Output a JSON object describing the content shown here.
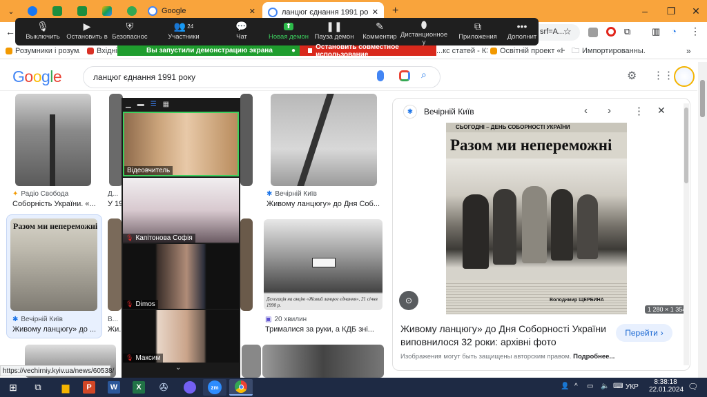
{
  "browser": {
    "tabs": [
      {
        "label": "",
        "icon": "facebook-icon",
        "color": "#1877f2"
      },
      {
        "label": "",
        "icon": "sheets-icon",
        "color": "#1e8e3e"
      },
      {
        "label": "",
        "icon": "sheets-icon",
        "color": "#1e8e3e"
      },
      {
        "label": "",
        "icon": "drive-icon",
        "color": "#f4b400"
      },
      {
        "label": "",
        "icon": "app-icon",
        "color": "#34a853"
      },
      {
        "label": "Google",
        "icon": "google-icon",
        "color": "#4285f4"
      },
      {
        "label": "ланцюг єднання 1991 року – G",
        "icon": "google-icon",
        "color": "#4285f4"
      }
    ],
    "url_fragment": "srf=A...",
    "bookmarks": [
      {
        "label": "Розумники і розум...",
        "color": "#f29900"
      },
      {
        "label": "Вхідні -",
        "color": "#d93025"
      },
      {
        "label": "...кс статей - КЗ...",
        "color": "#5f6368"
      },
      {
        "label": "Освітній проект «Н...",
        "color": "#f29900"
      },
      {
        "label": "Импортированны...",
        "color": "#5f6368"
      }
    ]
  },
  "zoom": {
    "controls": [
      {
        "label": "Выключить",
        "icon": "microphone-icon"
      },
      {
        "label": "Остановить в",
        "icon": "video-camera-icon"
      },
      {
        "label": "Безопаснос",
        "icon": "shield-icon"
      },
      {
        "label": "Участники",
        "icon": "participants-icon",
        "count": "24"
      },
      {
        "label": "Чат",
        "icon": "chat-icon"
      },
      {
        "label": "Новая демон",
        "icon": "share-screen-icon"
      },
      {
        "label": "Пауза демон",
        "icon": "pause-icon"
      },
      {
        "label": "Комментир",
        "icon": "pen-icon"
      },
      {
        "label": "Дистанционное у",
        "icon": "remote-control-icon"
      },
      {
        "label": "Приложения",
        "icon": "apps-icon"
      },
      {
        "label": "Дополнит",
        "icon": "more-icon"
      }
    ],
    "share_banner": "Вы запустили демонстрацию экрана",
    "stop_banner": "Остановить совместное использование",
    "participants": [
      {
        "name": "Відеовчитель",
        "muted": false
      },
      {
        "name": "Капітонова Софія",
        "muted": true
      },
      {
        "name": "Dimos",
        "muted": true
      },
      {
        "name": "Максим",
        "muted": true
      }
    ]
  },
  "google": {
    "logo": "Google",
    "query": "ланцюг єднання 1991 року",
    "results": [
      {
        "source": "Радіо Свобода",
        "title": "Соборність України. «...",
        "src_color": "#f29900"
      },
      {
        "source": "Д...",
        "title": "У 19...",
        "src_color": "#1a73e8"
      },
      {
        "source": "Вечірній Київ",
        "title": "Живому ланцюгу» до Дня Соб...",
        "src_color": "#1a73e8"
      },
      {
        "source": "Вечірній Київ",
        "title": "Живому ланцюгу» до ...",
        "src_color": "#1a73e8"
      },
      {
        "source": "В...",
        "title": "Жи...",
        "src_color": "#1a73e8"
      },
      {
        "source": "20 хвилин",
        "title": "Трималися за руки, а КДБ зні...",
        "src_color": "#5b4fcf"
      }
    ],
    "result_caption": "Делегація на акцію «Живий ланцюг єднання», 21 січня 1990 р.",
    "panel": {
      "source": "Вечірній Київ",
      "image_headline_small": "СЬОГОДНІ – ДЕНЬ СОБОРНОСТІ УКРАЇНИ",
      "image_headline": "Разом ми непереможні",
      "image_author": "Володимир ЩЕРБИНА",
      "image_dims": "1 280 × 1 354",
      "title": "Живому ланцюгу» до Дня Соборності України виповнилося 32 роки: архівні фото «Вечірньог...",
      "visit": "Перейти",
      "notice": "Изображения могут быть защищены авторским правом.",
      "more": "Подробнее..."
    }
  },
  "status_url": "https://vechirniy.kyiv.ua/news/60538/",
  "taskbar": {
    "lang": "УКР",
    "time": "8:38:18",
    "date": "22.01.2024"
  }
}
